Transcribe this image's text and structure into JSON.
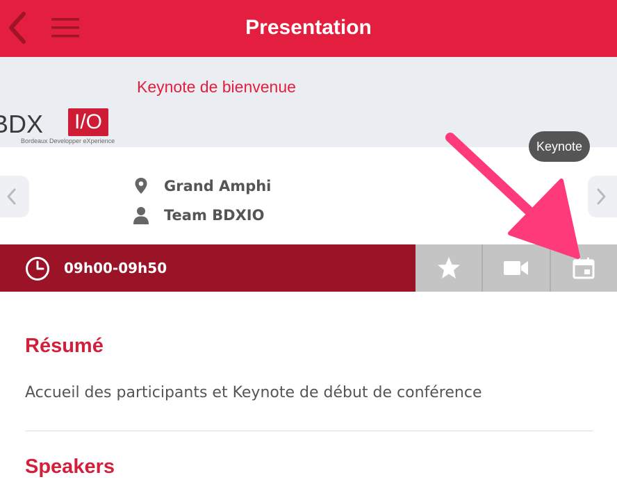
{
  "header": {
    "title": "Presentation",
    "back_icon": "chevron-left-icon",
    "menu_icon": "hamburger-menu-icon",
    "color": "#e31e3e"
  },
  "talk": {
    "title": "Keynote de bienvenue",
    "logo": {
      "text": "BDX",
      "box_text": "I/O",
      "subtitle": "Bordeaux Developper eXperience"
    },
    "tooltip": "Keynote",
    "room": "Grand Amphi",
    "speaker_team": "Team BDXIO"
  },
  "timebar": {
    "time": "09h00-09h50",
    "color": "#9a1326",
    "actions": [
      {
        "icon": "star-icon"
      },
      {
        "icon": "video-camera-icon"
      },
      {
        "icon": "calendar-icon"
      }
    ]
  },
  "content": {
    "summary_heading": "Résumé",
    "summary_text": "Accueil des participants et Keynote de début de conférence",
    "speakers_heading": "Speakers"
  },
  "annotation": {
    "arrow_color": "#ff3a7a"
  }
}
